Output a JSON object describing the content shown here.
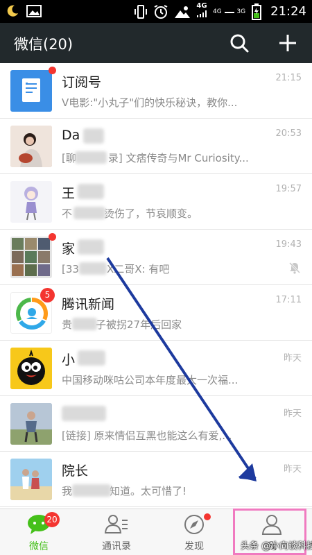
{
  "status_bar": {
    "network_top": "4G",
    "network_bottom": "4G",
    "network_bottom_sub": "3G",
    "time": "21:24"
  },
  "header": {
    "title": "微信(20)",
    "search_icon": "search-icon",
    "add_icon": "plus-icon"
  },
  "chats": [
    {
      "name": "订阅号",
      "preview": "V电影:\"小丸子\"们的快乐秘诀，教你...",
      "time": "21:15",
      "unread_dot": true
    },
    {
      "name": "Da",
      "preview": "[聊",
      "preview2": "录] 文痞传奇与Mr Curiosity...",
      "time": "20:53"
    },
    {
      "name": "王",
      "preview": "不",
      "preview2": "烫伤了，节哀顺变。",
      "time": "19:57"
    },
    {
      "name": "家",
      "preview": "[33",
      "preview2": "X二哥X: 有吧",
      "time": "19:43",
      "unread_dot": true,
      "muted": true
    },
    {
      "name": "腾讯新闻",
      "preview": "贵",
      "preview2": "子被拐27年后回家",
      "time": "17:11",
      "badge": "5"
    },
    {
      "name": "小",
      "preview": "中国移动咪咕公司本年度最大一次福...",
      "time": "昨天"
    },
    {
      "name": "",
      "preview": "[链接] 原来情侣互黑也能这么有爱,...",
      "time": "昨天"
    },
    {
      "name": "院长",
      "preview": "我",
      "preview2": "知道。太可惜了!",
      "time": "昨天"
    }
  ],
  "tabs": [
    {
      "label": "微信",
      "badge": "20",
      "active": true
    },
    {
      "label": "通讯录"
    },
    {
      "label": "发现",
      "dot": true
    },
    {
      "label": "我"
    }
  ],
  "watermark": "头条 @小向谈科技",
  "colors": {
    "accent_green": "#45c01a",
    "header_bg": "#22292c",
    "badge_red": "#f43530",
    "highlight_pink": "#f07ac0",
    "arrow_blue": "#1d3a9e"
  }
}
